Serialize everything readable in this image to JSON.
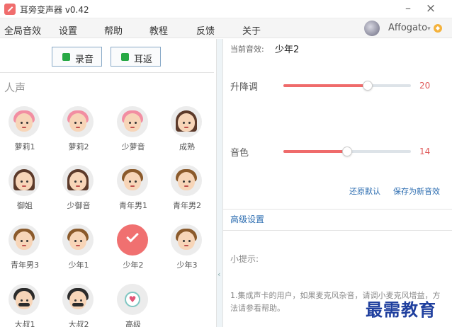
{
  "window": {
    "title": "耳旁变声器 v0.42",
    "minimize": "–",
    "close": "×"
  },
  "menu": {
    "items": [
      "全局音效",
      "设置",
      "帮助",
      "教程",
      "反馈",
      "关于"
    ],
    "user_name": "Affogato",
    "user_dropdown": "▾",
    "vip_glyph": "◆"
  },
  "left": {
    "record_label": "录音",
    "monitor_label": "耳返",
    "section_title": "人声",
    "voices": [
      {
        "label": "萝莉1",
        "face": "pink-girl"
      },
      {
        "label": "萝莉2",
        "face": "pink-girl"
      },
      {
        "label": "少萝音",
        "face": "pink-girl"
      },
      {
        "label": "成熟",
        "face": "long-hair-woman"
      },
      {
        "label": "御姐",
        "face": "long-hair-woman"
      },
      {
        "label": "少御音",
        "face": "long-hair-woman"
      },
      {
        "label": "青年男1",
        "face": "young-man"
      },
      {
        "label": "青年男2",
        "face": "young-man"
      },
      {
        "label": "青年男3",
        "face": "young-man"
      },
      {
        "label": "少年1",
        "face": "boy"
      },
      {
        "label": "少年2",
        "face": "selected-check"
      },
      {
        "label": "少年3",
        "face": "boy"
      },
      {
        "label": "大叔1",
        "face": "bearded-man"
      },
      {
        "label": "大叔2",
        "face": "bearded-man"
      },
      {
        "label": "高级",
        "face": "heart"
      }
    ],
    "selected_index": 10
  },
  "right": {
    "current_label": "当前音效:",
    "current_value": "少年2",
    "params": [
      {
        "label": "升降调",
        "value": 20,
        "fraction": 0.66
      },
      {
        "label": "音色",
        "value": 14,
        "fraction": 0.5
      }
    ],
    "reset_label": "还原默认",
    "save_label": "保存为新音效",
    "advanced_label": "高级设置",
    "tip_title": "小提示:",
    "tip_text": "1.集成声卡的用户，如果麦克风杂音，请调小麦克风增益，方法请参看帮助。"
  },
  "colors": {
    "accent": "#ef6b6b",
    "link": "#2b6cb0",
    "record_dot": "#27a844"
  },
  "watermark": "最需教育"
}
